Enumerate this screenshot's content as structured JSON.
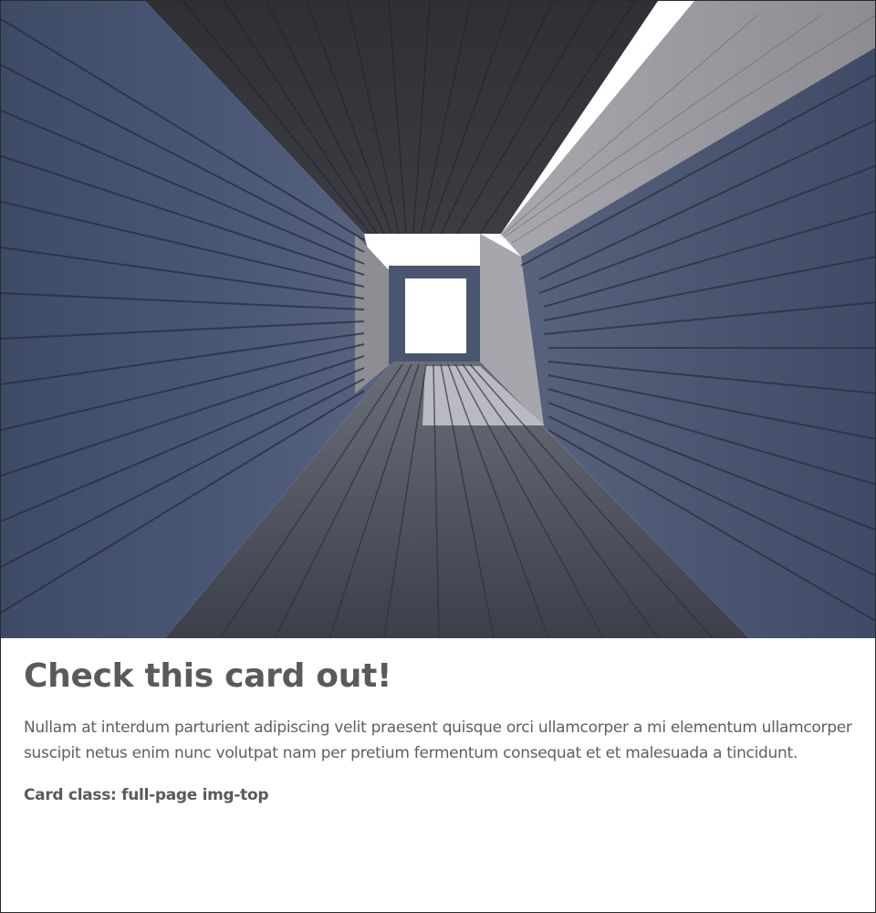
{
  "card": {
    "image_alt": "Wooden corridor with planked walls, floor and ceiling opening to a bright doorway",
    "title": "Check this card out!",
    "text": "Nullam at interdum parturient adipiscing velit praesent quisque orci ullamcorper a mi elementum ullamcorper suscipit netus enim nunc volutpat nam per pretium fermentum consequat et et malesuada a tincidunt.",
    "class_label": "Card class: full-page img-top"
  }
}
